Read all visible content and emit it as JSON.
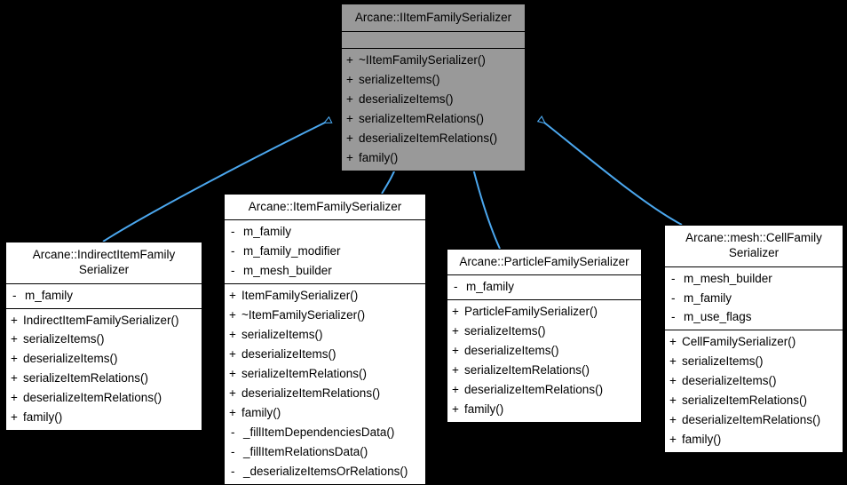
{
  "diagram": {
    "type": "uml-class-inheritance",
    "background_color": "#000000",
    "edge_color": "#4ba7ee",
    "highlight_fill": "#999999",
    "node_fill": "#ffffff",
    "border_color": "#000000"
  },
  "nodes": {
    "base": {
      "id": "IItemFamilySerializer",
      "title": "Arcane::IItemFamilySerializer",
      "highlighted": true,
      "attributes": [],
      "methods": [
        {
          "visibility": "+",
          "name": "~IItemFamilySerializer()"
        },
        {
          "visibility": "+",
          "name": "serializeItems()"
        },
        {
          "visibility": "+",
          "name": "deserializeItems()"
        },
        {
          "visibility": "+",
          "name": "serializeItemRelations()"
        },
        {
          "visibility": "+",
          "name": "deserializeItemRelations()"
        },
        {
          "visibility": "+",
          "name": "family()"
        }
      ]
    },
    "indirect": {
      "id": "IndirectItemFamilySerializer",
      "title": "Arcane::IndirectItemFamily\nSerializer",
      "highlighted": false,
      "attributes": [
        {
          "visibility": "-",
          "name": "m_family"
        }
      ],
      "methods": [
        {
          "visibility": "+",
          "name": "IndirectItemFamilySerializer()"
        },
        {
          "visibility": "+",
          "name": "serializeItems()"
        },
        {
          "visibility": "+",
          "name": "deserializeItems()"
        },
        {
          "visibility": "+",
          "name": "serializeItemRelations()"
        },
        {
          "visibility": "+",
          "name": "deserializeItemRelations()"
        },
        {
          "visibility": "+",
          "name": "family()"
        }
      ]
    },
    "item": {
      "id": "ItemFamilySerializer",
      "title": "Arcane::ItemFamilySerializer",
      "highlighted": false,
      "attributes": [
        {
          "visibility": "-",
          "name": "m_family"
        },
        {
          "visibility": "-",
          "name": "m_family_modifier"
        },
        {
          "visibility": "-",
          "name": "m_mesh_builder"
        }
      ],
      "methods": [
        {
          "visibility": "+",
          "name": "ItemFamilySerializer()"
        },
        {
          "visibility": "+",
          "name": "~ItemFamilySerializer()"
        },
        {
          "visibility": "+",
          "name": "serializeItems()"
        },
        {
          "visibility": "+",
          "name": "deserializeItems()"
        },
        {
          "visibility": "+",
          "name": "serializeItemRelations()"
        },
        {
          "visibility": "+",
          "name": "deserializeItemRelations()"
        },
        {
          "visibility": "+",
          "name": "family()"
        },
        {
          "visibility": "-",
          "name": "_fillItemDependenciesData()"
        },
        {
          "visibility": "-",
          "name": "_fillItemRelationsData()"
        },
        {
          "visibility": "-",
          "name": "_deserializeItemsOrRelations()"
        }
      ]
    },
    "particle": {
      "id": "ParticleFamilySerializer",
      "title": "Arcane::ParticleFamilySerializer",
      "highlighted": false,
      "attributes": [
        {
          "visibility": "-",
          "name": "m_family"
        }
      ],
      "methods": [
        {
          "visibility": "+",
          "name": "ParticleFamilySerializer()"
        },
        {
          "visibility": "+",
          "name": "serializeItems()"
        },
        {
          "visibility": "+",
          "name": "deserializeItems()"
        },
        {
          "visibility": "+",
          "name": "serializeItemRelations()"
        },
        {
          "visibility": "+",
          "name": "deserializeItemRelations()"
        },
        {
          "visibility": "+",
          "name": "family()"
        }
      ]
    },
    "cell": {
      "id": "CellFamilySerializer",
      "title": "Arcane::mesh::CellFamily\nSerializer",
      "highlighted": false,
      "attributes": [
        {
          "visibility": "-",
          "name": "m_mesh_builder"
        },
        {
          "visibility": "-",
          "name": "m_family"
        },
        {
          "visibility": "-",
          "name": "m_use_flags"
        }
      ],
      "methods": [
        {
          "visibility": "+",
          "name": "CellFamilySerializer()"
        },
        {
          "visibility": "+",
          "name": "serializeItems()"
        },
        {
          "visibility": "+",
          "name": "deserializeItems()"
        },
        {
          "visibility": "+",
          "name": "serializeItemRelations()"
        },
        {
          "visibility": "+",
          "name": "deserializeItemRelations()"
        },
        {
          "visibility": "+",
          "name": "family()"
        }
      ]
    }
  },
  "edges": [
    {
      "from": "IndirectItemFamilySerializer",
      "to": "IItemFamilySerializer",
      "relation": "inheritance"
    },
    {
      "from": "ItemFamilySerializer",
      "to": "IItemFamilySerializer",
      "relation": "inheritance"
    },
    {
      "from": "ParticleFamilySerializer",
      "to": "IItemFamilySerializer",
      "relation": "inheritance"
    },
    {
      "from": "CellFamilySerializer",
      "to": "IItemFamilySerializer",
      "relation": "inheritance"
    }
  ]
}
